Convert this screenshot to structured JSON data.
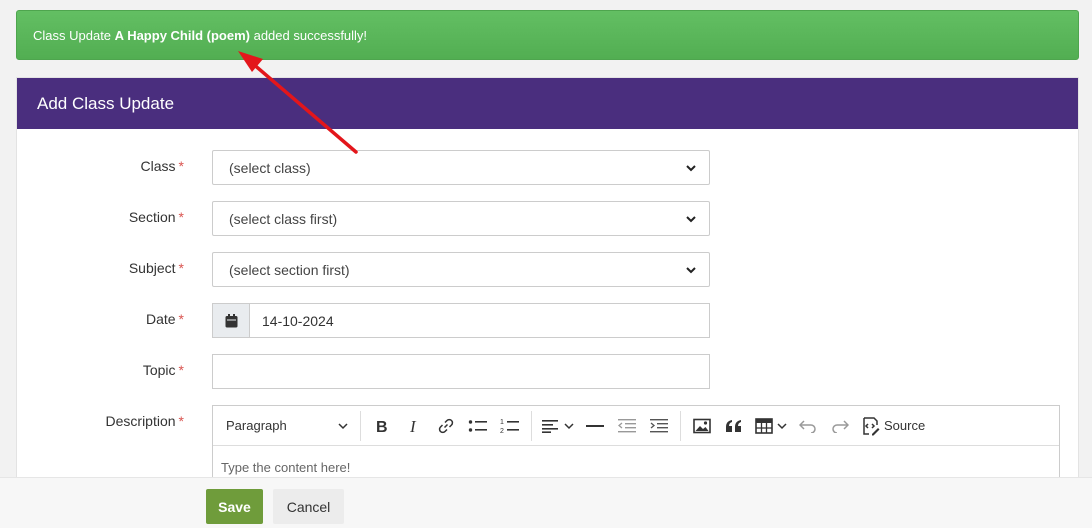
{
  "alert": {
    "prefix": "Class Update ",
    "item": "A Happy Child (poem)",
    "suffix": " added successfully!"
  },
  "panel": {
    "title": "Add Class Update"
  },
  "form": {
    "class": {
      "label": "Class",
      "required": "*",
      "value": "(select class)"
    },
    "section": {
      "label": "Section",
      "required": "*",
      "value": "(select class first)"
    },
    "subject": {
      "label": "Subject",
      "required": "*",
      "value": "(select section first)"
    },
    "date": {
      "label": "Date",
      "required": "*",
      "value": "14-10-2024"
    },
    "topic": {
      "label": "Topic",
      "required": "*",
      "value": ""
    },
    "description": {
      "label": "Description",
      "required": "*",
      "placeholder": "Type the content here!"
    }
  },
  "editor": {
    "paragraph_label": "Paragraph",
    "source_label": "Source"
  },
  "footer": {
    "save_label": "Save",
    "cancel_label": "Cancel"
  },
  "colors": {
    "alert": "#5cb85c",
    "panel_header": "#4a2e7e",
    "save": "#6f9c3b",
    "required": "#d9534f",
    "annotation_arrow": "#e3161b"
  }
}
